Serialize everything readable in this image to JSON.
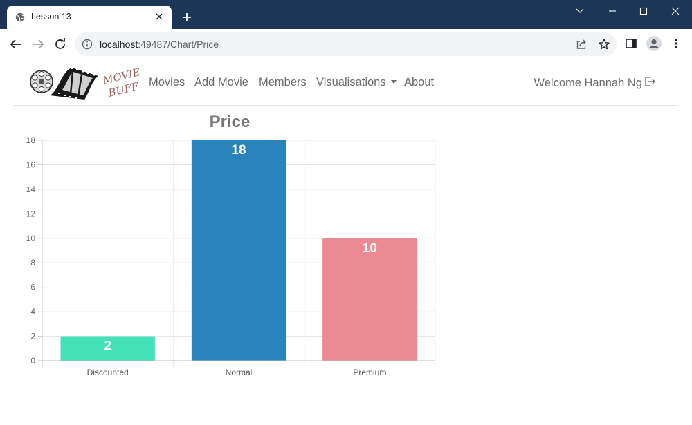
{
  "browser": {
    "tab_title": "Lesson 13",
    "url_host": "localhost",
    "url_rest": ":49487/Chart/Price"
  },
  "site": {
    "logo_text_1": "MOVIE",
    "logo_text_2": "BUFF",
    "nav": {
      "movies": "Movies",
      "add_movie": "Add Movie",
      "members": "Members",
      "visualisations": "Visualisations",
      "about": "About"
    },
    "welcome": "Welcome Hannah Ng"
  },
  "chart_data": {
    "type": "bar",
    "title": "Price",
    "xlabel": "",
    "ylabel": "",
    "categories": [
      "Discounted",
      "Normal",
      "Premium"
    ],
    "values": [
      2,
      18,
      10
    ],
    "ylim": [
      0,
      18
    ],
    "yticks": [
      0,
      2,
      4,
      6,
      8,
      10,
      12,
      14,
      16,
      18
    ],
    "colors": [
      "#43e1b8",
      "#2b83bb",
      "#eb8a92"
    ],
    "data_labels": [
      "2",
      "18",
      "10"
    ],
    "grid": true,
    "legend": "none"
  }
}
